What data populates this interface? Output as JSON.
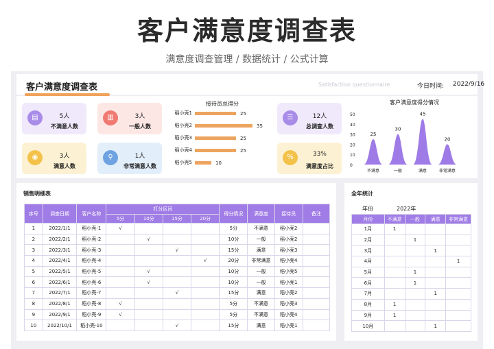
{
  "header": {
    "title": "客户满意度调查表",
    "subtitle": "满意度调查管理 /  数据统计 /  公式计算"
  },
  "sheet": {
    "title": "客户满意度调查表",
    "subtitle_en": "Satisfaction questionnaire",
    "date_label": "今日时间:",
    "date_value": "2022/9/16"
  },
  "cards": [
    {
      "value": "5人",
      "label": "不满意人数",
      "icon": "document-icon",
      "color": "#a98be8",
      "bg": "#efe9fb"
    },
    {
      "value": "3人",
      "label": "一般人数",
      "icon": "chart-icon",
      "color": "#f07a72",
      "bg": "#fde7e5"
    },
    {
      "value": "3人",
      "label": "满意人数",
      "icon": "cup-icon",
      "color": "#f3c24a",
      "bg": "#fdf1d3"
    },
    {
      "value": "1人",
      "label": "非常满意人数",
      "icon": "person-search-icon",
      "color": "#6fa2e0",
      "bg": "#e3eefb"
    },
    {
      "value": "12人",
      "label": "总调查人数",
      "icon": "list-icon",
      "color": "#a98be8",
      "bg": "#efe9fb"
    },
    {
      "value": "33%",
      "label": "满意度占比",
      "icon": "percent-icon",
      "color": "#f3c24a",
      "bg": "#fdf1d3"
    }
  ],
  "chart_data": [
    {
      "type": "bar",
      "title": "接待员总得分",
      "categories": [
        "稻小壳1",
        "稻小壳2",
        "稻小壳3",
        "稻小壳4",
        "稻小壳5"
      ],
      "values": [
        25,
        35,
        25,
        25,
        10
      ]
    },
    {
      "type": "area",
      "title": "客户满意度得分情况",
      "categories": [
        "不满意",
        "一般",
        "满意",
        "非常满意"
      ],
      "values": [
        25,
        30,
        45,
        20
      ],
      "ylim": [
        0,
        50
      ],
      "yticks": [
        0,
        10,
        20,
        30,
        40,
        50
      ]
    }
  ],
  "sales": {
    "title": "销售明细表",
    "headers": [
      "序号",
      "调查日期",
      "客户名称",
      "打分区间",
      "得分情况",
      "满意度",
      "接待员",
      "备注"
    ],
    "score_cols": [
      "5分",
      "10分",
      "15分",
      "20分"
    ],
    "check": "√",
    "rows": [
      [
        "1",
        "2022/1/1",
        "稻小壳-1",
        0,
        "5分",
        "不满意",
        "稻小壳2"
      ],
      [
        "2",
        "2022/2/1",
        "稻小壳-2",
        1,
        "10分",
        "一般",
        "稻小壳2"
      ],
      [
        "3",
        "2022/3/1",
        "稻小壳-3",
        2,
        "15分",
        "满意",
        "稻小壳3"
      ],
      [
        "4",
        "2022/4/1",
        "稻小壳-4",
        3,
        "20分",
        "非常满意",
        "稻小壳4"
      ],
      [
        "5",
        "2022/5/1",
        "稻小壳-5",
        1,
        "10分",
        "一般",
        "稻小壳5"
      ],
      [
        "6",
        "2022/6/1",
        "稻小壳-6",
        1,
        "10分",
        "一般",
        "稻小壳1"
      ],
      [
        "7",
        "2022/7/1",
        "稻小壳-7",
        2,
        "15分",
        "满意",
        "稻小壳2"
      ],
      [
        "8",
        "2022/8/1",
        "稻小壳-8",
        0,
        "5分",
        "不满意",
        "稻小壳3"
      ],
      [
        "9",
        "2022/9/1",
        "稻小壳-9",
        0,
        "5分",
        "不满意",
        "稻小壳4"
      ],
      [
        "10",
        "2022/10/1",
        "稻小壳-10",
        2,
        "15分",
        "满意",
        "稻小壳1"
      ]
    ]
  },
  "annual": {
    "title": "全年统计",
    "year_label": "年份",
    "year_value": "2022年",
    "headers": [
      "月份",
      "不满意",
      "一般",
      "满意",
      "非常满意"
    ],
    "rows": [
      [
        "1月",
        "1",
        "",
        "",
        ""
      ],
      [
        "2月",
        "",
        "1",
        "",
        ""
      ],
      [
        "3月",
        "",
        "",
        "1",
        ""
      ],
      [
        "4月",
        "",
        "",
        "",
        "1"
      ],
      [
        "5月",
        "",
        "1",
        "",
        ""
      ],
      [
        "6月",
        "",
        "1",
        "",
        ""
      ],
      [
        "7月",
        "",
        "",
        "1",
        ""
      ],
      [
        "8月",
        "1",
        "",
        "",
        ""
      ],
      [
        "9月",
        "1",
        "",
        "",
        ""
      ],
      [
        "10月",
        "",
        "",
        "1",
        ""
      ]
    ]
  }
}
